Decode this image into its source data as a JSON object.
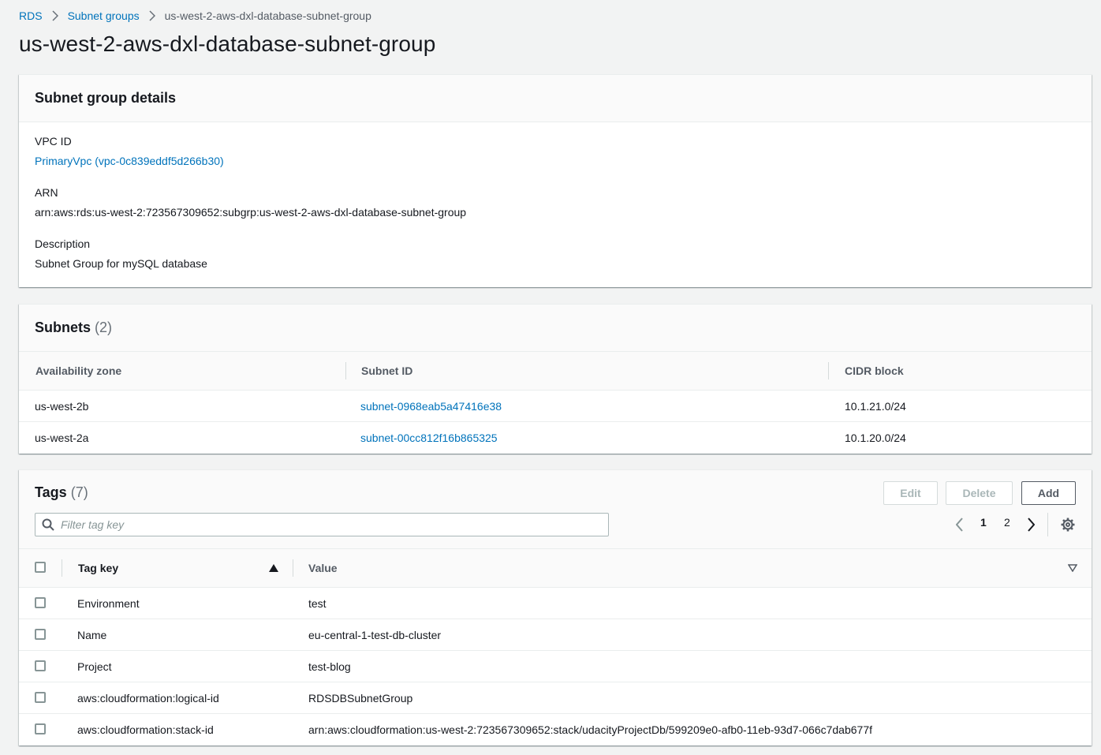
{
  "breadcrumb": {
    "root": "RDS",
    "parent": "Subnet groups",
    "current": "us-west-2-aws-dxl-database-subnet-group"
  },
  "page_title": "us-west-2-aws-dxl-database-subnet-group",
  "details": {
    "title": "Subnet group details",
    "vpc_label": "VPC ID",
    "vpc_value": "PrimaryVpc (vpc-0c839eddf5d266b30)",
    "arn_label": "ARN",
    "arn_value": "arn:aws:rds:us-west-2:723567309652:subgrp:us-west-2-aws-dxl-database-subnet-group",
    "desc_label": "Description",
    "desc_value": "Subnet Group for mySQL database"
  },
  "subnets": {
    "title": "Subnets",
    "count": "(2)",
    "columns": [
      "Availability zone",
      "Subnet ID",
      "CIDR block"
    ],
    "rows": [
      {
        "az": "us-west-2b",
        "subnet_id": "subnet-0968eab5a47416e38",
        "cidr": "10.1.21.0/24"
      },
      {
        "az": "us-west-2a",
        "subnet_id": "subnet-00cc812f16b865325",
        "cidr": "10.1.20.0/24"
      }
    ]
  },
  "tags": {
    "title": "Tags",
    "count": "(7)",
    "buttons": {
      "edit": "Edit",
      "delete": "Delete",
      "add": "Add"
    },
    "filter_placeholder": "Filter tag key",
    "pagination": {
      "pages": [
        "1",
        "2"
      ],
      "current": "1"
    },
    "columns": {
      "key": "Tag key",
      "value": "Value"
    },
    "rows": [
      {
        "key": "Environment",
        "value": "test"
      },
      {
        "key": "Name",
        "value": "eu-central-1-test-db-cluster"
      },
      {
        "key": "Project",
        "value": "test-blog"
      },
      {
        "key": "aws:cloudformation:logical-id",
        "value": "RDSDBSubnetGroup"
      },
      {
        "key": "aws:cloudformation:stack-id",
        "value": "arn:aws:cloudformation:us-west-2:723567309652:stack/udacityProjectDb/599209e0-afb0-11eb-93d7-066c7dab677f"
      }
    ]
  },
  "icons": {
    "breadcrumb_separator": "chevron-right-icon",
    "search": "search-icon",
    "prev": "chevron-left-icon",
    "next": "chevron-right-icon",
    "settings": "gear-icon",
    "sort": "sort-ascending-icon",
    "column_menu": "caret-down-icon"
  },
  "colors": {
    "link": "#0073bb",
    "background": "#f2f3f3",
    "panel_header": "#fafafa"
  }
}
